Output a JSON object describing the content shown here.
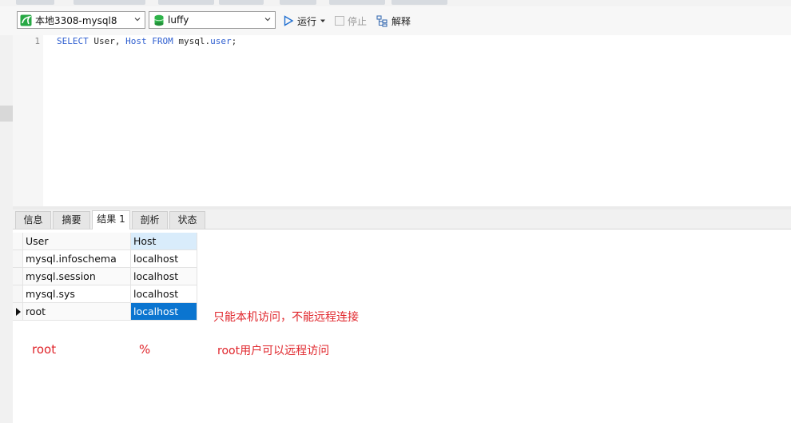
{
  "connection": {
    "selected": "本地3308-mysql8"
  },
  "database": {
    "selected": "luffy"
  },
  "toolbar": {
    "run_label": "运行",
    "stop_label": "停止",
    "explain_label": "解释"
  },
  "editor": {
    "line_number": "1",
    "sql": {
      "kw_select": "SELECT",
      "t_user": " User, ",
      "kw_host": "Host",
      "kw_from": " FROM",
      "t_mysql": " mysql.",
      "kw_user": "user",
      "semicolon": ";"
    }
  },
  "tabs": [
    "信息",
    "摘要",
    "结果 1",
    "剖析",
    "状态"
  ],
  "grid": {
    "columns": [
      "User",
      "Host"
    ],
    "rows": [
      [
        "mysql.infoschema",
        "localhost"
      ],
      [
        "mysql.session",
        "localhost"
      ],
      [
        "mysql.sys",
        "localhost"
      ],
      [
        "root",
        "localhost"
      ]
    ]
  },
  "annotations": {
    "note1": "只能本机访问，不能远程连接",
    "root": "root",
    "percent": "%",
    "note2": "root用户可以远程访问"
  },
  "colors": {
    "keyword": "#2f5fd0",
    "selection": "#0b75d0",
    "annotation": "#e0252b"
  }
}
